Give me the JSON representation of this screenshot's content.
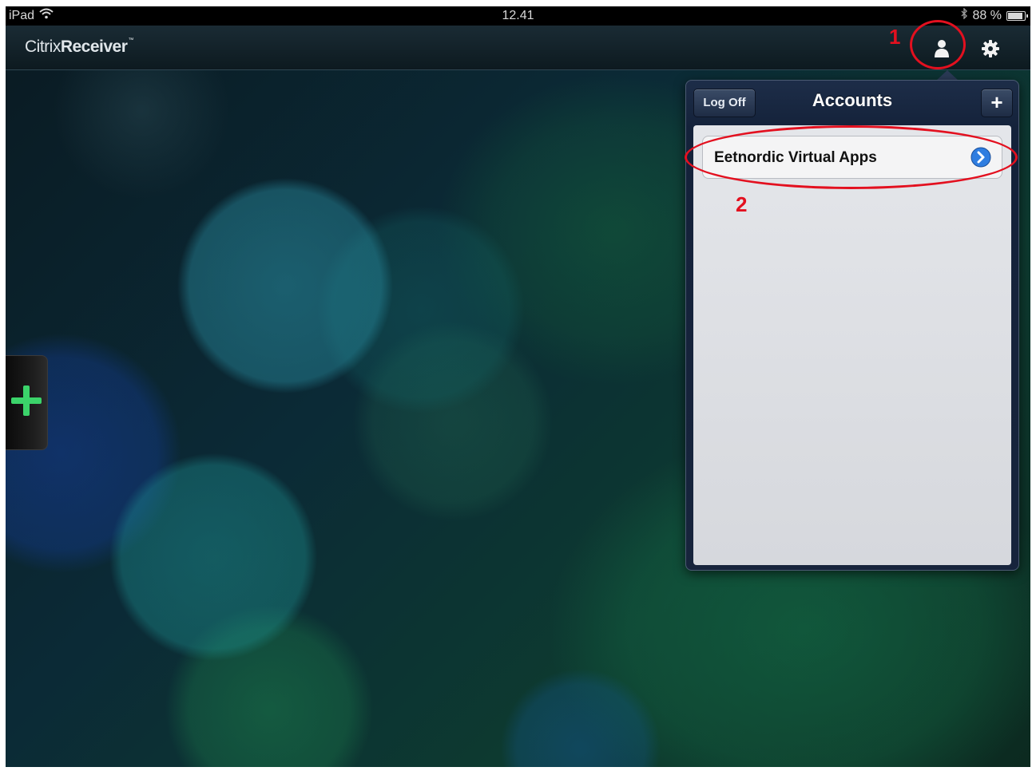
{
  "status_bar": {
    "device": "iPad",
    "time": "12.41",
    "battery_text": "88 %",
    "battery_level": 0.88
  },
  "app_bar": {
    "logo_light": "Citrix",
    "logo_bold": "Receiver",
    "logo_tm": "™"
  },
  "annotations": {
    "step1": "1",
    "step2": "2",
    "color": "#e3101f"
  },
  "popover": {
    "title": "Accounts",
    "logoff_label": "Log Off",
    "add_label": "+",
    "accounts": [
      {
        "name": "Eetnordic Virtual Apps"
      }
    ]
  },
  "colors": {
    "accent_blue": "#2f7de0",
    "add_green": "#3bd36a"
  },
  "icons": [
    "wifi-icon",
    "bluetooth-icon",
    "battery-icon",
    "account-icon",
    "gear-icon",
    "add-icon",
    "disclosure-icon"
  ]
}
